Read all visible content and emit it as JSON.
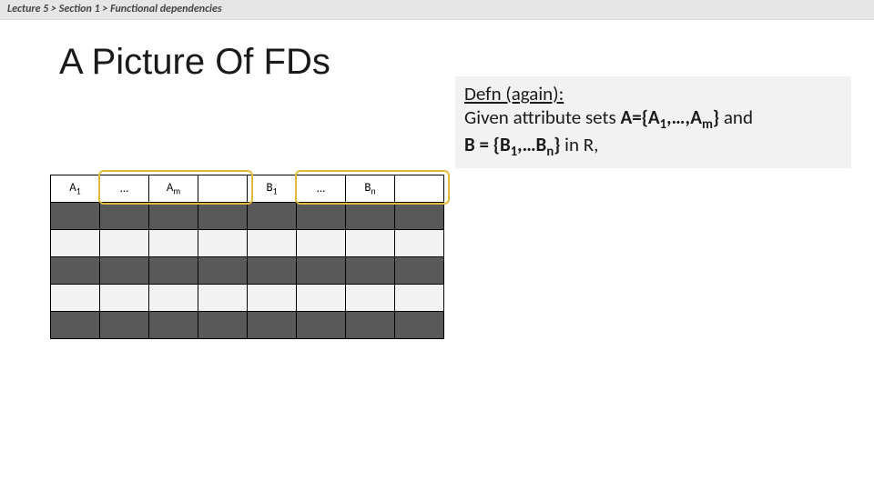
{
  "breadcrumb": {
    "lecture": "Lecture 5",
    "sep1": ">",
    "section": "Section 1",
    "sep2": ">",
    "topic": "Functional dependencies"
  },
  "title": "A Picture Of FDs",
  "defn": {
    "heading": "Defn (again):",
    "line_plain1": "Given attribute sets ",
    "A_label": "A={A",
    "A_sub1": "1",
    "A_mid": ",…,A",
    "A_subm": "m",
    "A_close": "}",
    "line_plain2": " and",
    "B_label": "B = {B",
    "B_sub1": "1",
    "B_mid": ",…B",
    "B_subn": "n",
    "B_close": "}",
    "line_tail": " in R,"
  },
  "table": {
    "headers": {
      "c1": {
        "sym": "A",
        "sub": "1"
      },
      "c2": {
        "sym": "…",
        "sub": ""
      },
      "c3": {
        "sym": "A",
        "sub": "m"
      },
      "c4": {
        "sym": "",
        "sub": ""
      },
      "c5": {
        "sym": "B",
        "sub": "1"
      },
      "c6": {
        "sym": "…",
        "sub": ""
      },
      "c7": {
        "sym": "B",
        "sub": "n"
      },
      "c8": {
        "sym": "",
        "sub": ""
      }
    }
  }
}
